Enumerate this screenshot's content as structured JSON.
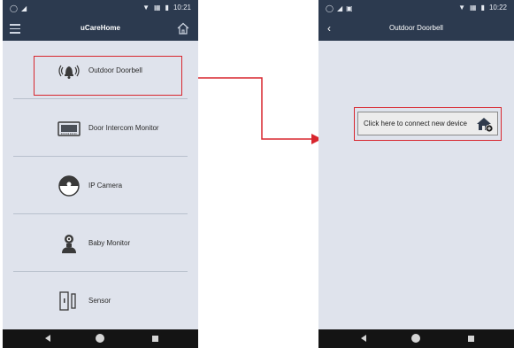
{
  "left_screen": {
    "status": {
      "time": "10:21"
    },
    "appbar": {
      "title": "uCareHome"
    },
    "menu": [
      {
        "label": "Outdoor Doorbell",
        "icon": "doorbell-icon"
      },
      {
        "label": "Door Intercom Monitor",
        "icon": "intercom-monitor-icon"
      },
      {
        "label": "IP Camera",
        "icon": "ip-camera-icon"
      },
      {
        "label": "Baby Monitor",
        "icon": "baby-monitor-icon"
      },
      {
        "label": "Sensor",
        "icon": "sensor-icon"
      }
    ]
  },
  "right_screen": {
    "status": {
      "time": "10:22"
    },
    "appbar": {
      "title": "Outdoor Doorbell"
    },
    "connect_button": {
      "label": "Click here to connect new device",
      "icon": "add-device-home-icon"
    }
  },
  "annotation": {
    "color": "#d8262e"
  }
}
